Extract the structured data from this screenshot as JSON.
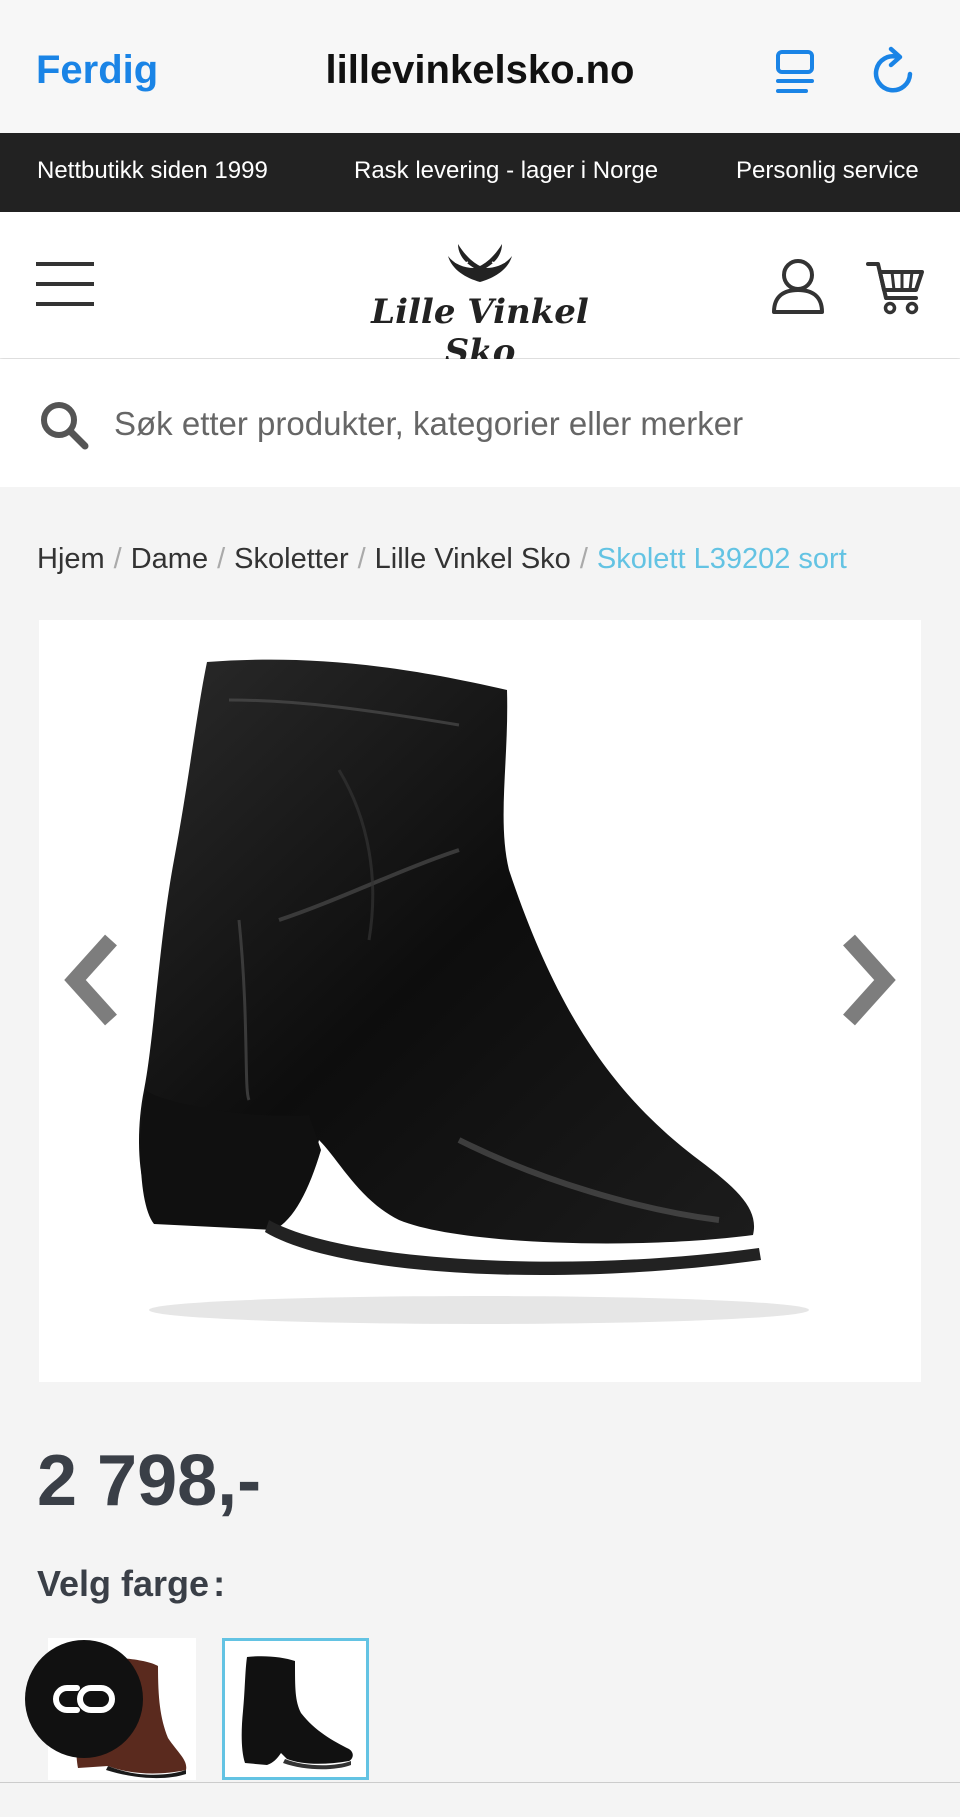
{
  "browser": {
    "done_label": "Ferdig",
    "url_title": "lillevinkelsko.no"
  },
  "usp_bar": {
    "items": [
      "Nettbutikk siden 1999",
      "Rask levering - lager i Norge",
      "Personlig service"
    ]
  },
  "header": {
    "logo_text": "Lille Vinkel Sko"
  },
  "search": {
    "placeholder": "Søk etter produkter, kategorier eller merker",
    "value": ""
  },
  "breadcrumb": {
    "items": [
      "Hjem",
      "Dame",
      "Skoletter",
      "Lille Vinkel Sko"
    ],
    "current": "Skolett L39202 sort",
    "separator": "/"
  },
  "product": {
    "price": "2 798,-",
    "color_label": "Velg farge",
    "color_label_suffix": ":"
  },
  "colors": {
    "accent": "#63c3e3",
    "link_blue": "#1a84e6",
    "usp_bg": "#222222",
    "price_text": "#3a3f47"
  },
  "icons": {
    "browser": [
      "reader-icon",
      "reload-icon"
    ],
    "header": [
      "menu-icon",
      "user-icon",
      "cart-icon"
    ],
    "search": "search-icon",
    "gallery": [
      "chevron-left-icon",
      "chevron-right-icon"
    ],
    "chat": "chat-icon"
  }
}
